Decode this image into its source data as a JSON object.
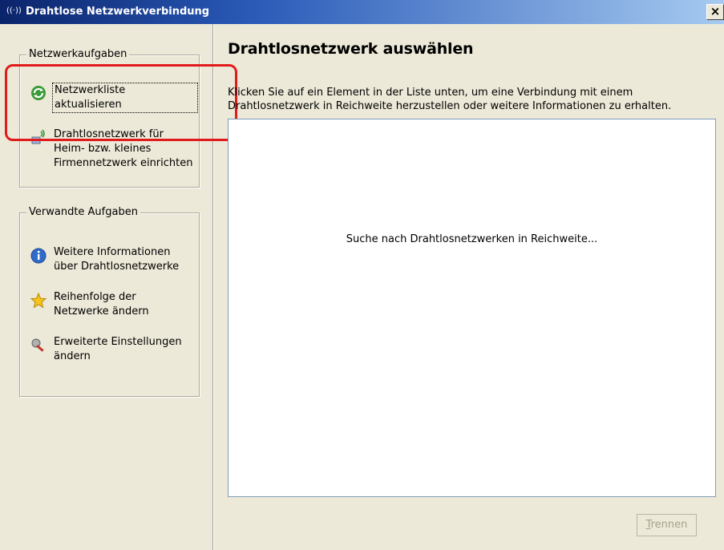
{
  "window": {
    "title": "Drahtlose Netzwerkverbindung",
    "icon": "wireless-antenna-icon",
    "close_label": "×"
  },
  "sidebar": {
    "network_tasks": {
      "legend": "Netzwerkaufgaben",
      "items": [
        {
          "icon": "refresh-icon",
          "label": "Netzwerkliste aktualisieren"
        },
        {
          "icon": "wireless-setup-icon",
          "label_lines": [
            "Drahtlosnetzwerk für",
            "Heim- bzw. kleines",
            "Firmennetzwerk einrichten"
          ]
        }
      ]
    },
    "related_tasks": {
      "legend": "Verwandte Aufgaben",
      "items": [
        {
          "icon": "info-icon",
          "label_lines": [
            "Weitere Informationen",
            "über Drahtlosnetzwerke"
          ]
        },
        {
          "icon": "star-icon",
          "label_lines": [
            "Reihenfolge der",
            "Netzwerke ändern"
          ]
        },
        {
          "icon": "settings-wrench-icon",
          "label_lines": [
            "Erweiterte Einstellungen",
            "ändern"
          ]
        }
      ]
    }
  },
  "main": {
    "title": "Drahtlosnetzwerk auswählen",
    "instruction_lines": [
      "Klicken Sie auf ein Element in der Liste unten, um eine Verbindung mit einem",
      "Drahtlosnetzwerk in Reichweite herzustellen oder weitere Informationen zu erhalten."
    ],
    "list_status": "Suche nach Drahtlosnetzwerken in Reichweite...",
    "disconnect_button": {
      "mnemonic": "T",
      "rest": "rennen"
    }
  },
  "colors": {
    "annotation_red": "#e11b1b",
    "titlebar_dark": "#0a246a",
    "panel_bg": "#ece9d8"
  }
}
